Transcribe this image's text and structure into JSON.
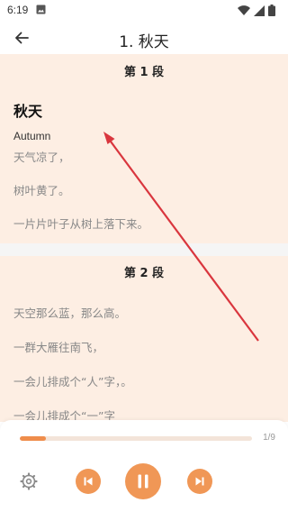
{
  "status_bar": {
    "time": "6:19"
  },
  "app_bar": {
    "title": "1. 秋天"
  },
  "sections": [
    {
      "heading": "第 1 段",
      "title": "秋天",
      "subtitle": "Autumn",
      "lines": [
        "天气凉了，",
        "树叶黄了。",
        "一片片叶子从树上落下来。"
      ]
    },
    {
      "heading": "第 2 段",
      "lines": [
        "天空那么蓝，那么高。",
        "一群大雁往南飞，",
        "一会儿排成个“人”字，。",
        "一会儿排成个“一”字"
      ]
    }
  ],
  "player": {
    "progress_text": "1/9",
    "progress_fraction": 0.111,
    "accent_color": "#f09756"
  },
  "colors": {
    "card_background": "#fdeee3",
    "annotation_arrow": "#d9363e"
  }
}
